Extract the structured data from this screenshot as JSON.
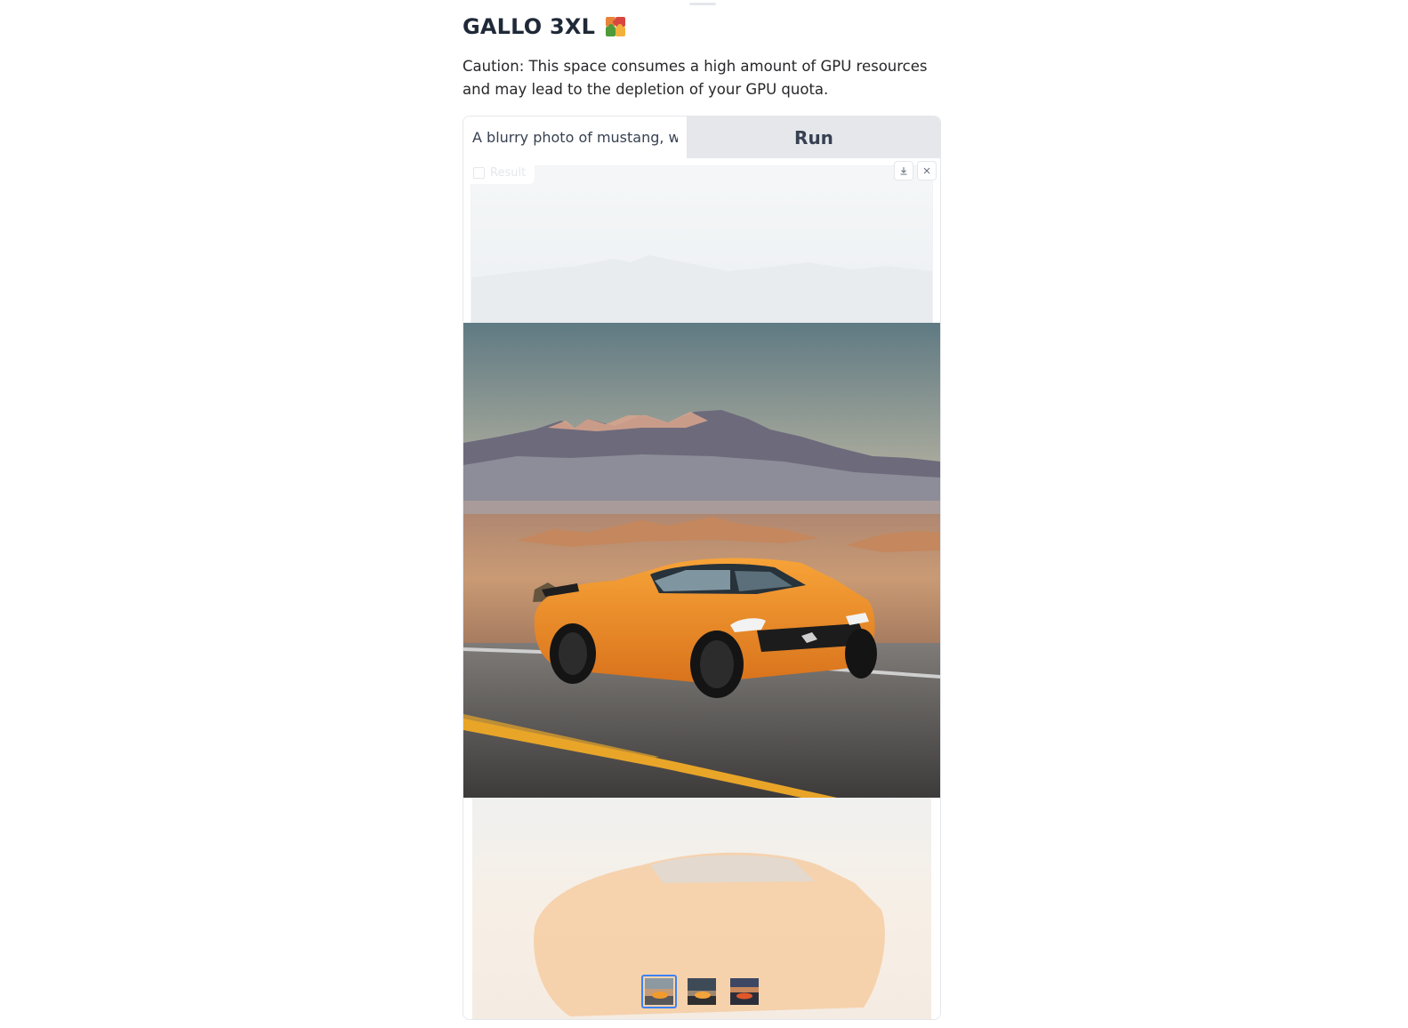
{
  "app": {
    "title": "GALLO 3XL",
    "title_icon": "puzzle-piece-icon",
    "caution": "Caution: This space consumes a high amount of GPU resources and may lead to the depletion of your GPU quota."
  },
  "prompt": {
    "value": "A blurry photo of mustang, w",
    "run_label": "Run"
  },
  "result": {
    "label": "Result",
    "label_icon": "image-icon",
    "actions": [
      "download-icon",
      "close-icon"
    ],
    "thumbnails": [
      {
        "name": "thumbnail-1",
        "selected": true
      },
      {
        "name": "thumbnail-2",
        "selected": false
      },
      {
        "name": "thumbnail-3",
        "selected": false
      }
    ]
  },
  "colors": {
    "accent": "#3b82f6",
    "button_bg": "#e5e7eb",
    "text": "#1f2937"
  }
}
